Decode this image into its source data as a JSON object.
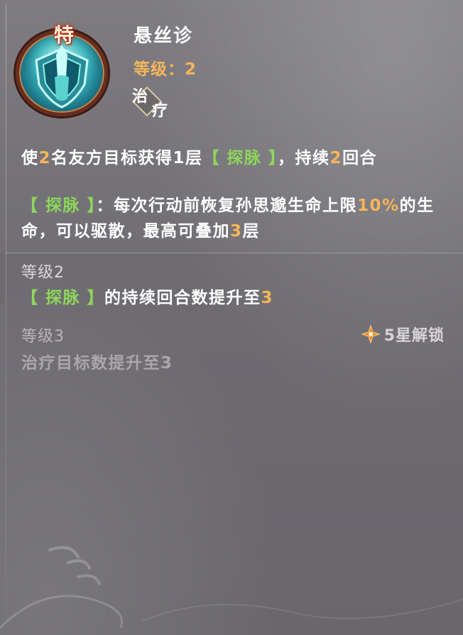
{
  "skill": {
    "special_tag": "特",
    "name": "悬丝诊",
    "level_label": "等级：",
    "level_value": "2",
    "type_char_1": "治",
    "type_char_2": "疗",
    "icon": "shield-hands-icon"
  },
  "description": {
    "line1_a": "使",
    "line1_num1": "2",
    "line1_b": "名友方目标获得1层",
    "line1_kw": "【 探脉 】",
    "line1_c": "，持续",
    "line1_num2": "2",
    "line1_d": "回合",
    "detail_kw": "【 探脉 】",
    "detail_a": "：每次行动前恢复孙思邈生命上限",
    "detail_num": "10%",
    "detail_b": "的生命，可以驱散，最高可叠加",
    "detail_num2": "3",
    "detail_c": "层"
  },
  "upgrades": {
    "lv2_title": "等级2",
    "lv2_kw": "【 探脉 】",
    "lv2_text": "的持续回合数提升至",
    "lv2_num": "3",
    "lv3_title": "等级3",
    "lv3_text": "治疗目标数提升至3",
    "lv3_unlock": "5星解锁",
    "unlock_icon": "orange-star-icon"
  },
  "colors": {
    "accent_orange": "#f5b55a",
    "keyword_green": "#8ed65a",
    "text_white": "#ffffff",
    "text_dim": "#a9a7ab"
  }
}
